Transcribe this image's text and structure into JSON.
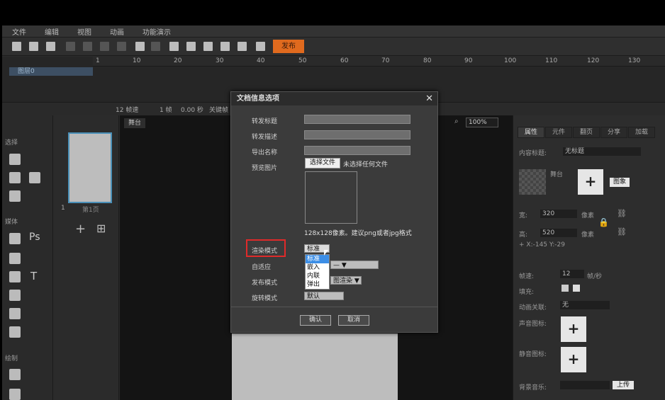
{
  "menu": [
    "文件",
    "编辑",
    "视图",
    "动画",
    "功能演示"
  ],
  "toolbar": {
    "publish_label": "发布"
  },
  "timeline": {
    "ticks": [
      "1",
      "10",
      "20",
      "30",
      "40",
      "50",
      "60",
      "70",
      "80",
      "90",
      "100",
      "110",
      "120",
      "130"
    ],
    "layer_name": "图层0",
    "status": {
      "fps": "12 帧速",
      "frame": "1 帧",
      "time": "0.00 秒",
      "keyframe": "关键帧"
    }
  },
  "left_panel": {
    "select_section": "选择",
    "media_section": "媒体",
    "draw_section": "绘制",
    "ps_label": "Ps",
    "text_label": "T"
  },
  "pages": {
    "page_number": "1",
    "page_label": "第1页"
  },
  "stage": {
    "tab_label": "舞台",
    "zoom": "100%"
  },
  "right_panel": {
    "tabs": [
      "属性",
      "元件",
      "翻页",
      "分享",
      "加载"
    ],
    "content_title_label": "内容标题:",
    "content_title_value": "无标题",
    "stage_label": "舞台",
    "image_button": "图象",
    "width_label": "宽:",
    "width_value": "320",
    "width_unit": "像素",
    "height_label": "高:",
    "height_value": "520",
    "height_unit": "像素",
    "coords": "+  X:-145   Y:-29",
    "fps_label": "帧速:",
    "fps_value": "12",
    "fps_unit": "帧/秒",
    "fill_label": "填充:",
    "anim_link_label": "动画关联:",
    "anim_link_value": "无",
    "sound_icon_label": "声音图标:",
    "mute_icon_label": "静音图标:",
    "bg_music_label": "背景音乐:",
    "upload_button": "上传"
  },
  "dialog": {
    "title": "文档信息选项",
    "share_title_label": "转发标题",
    "share_desc_label": "转发描述",
    "export_name_label": "导出名称",
    "preview_label": "预览图片",
    "choose_file": "选择文件",
    "no_file": "未选择任何文件",
    "size_hint": "128x128像素。建议png或者jpg格式",
    "render_mode_label": "渲染模式",
    "render_mode_value": "标准",
    "adaptive_label": "自适应",
    "adaptive_value": "— ▼",
    "publish_mode_label": "发布模式",
    "publish_mode_value": "图渲染 ▼",
    "rotate_mode_label": "旋转模式",
    "rotate_mode_value": "默认",
    "dropdown_options": [
      "标准",
      "嵌入",
      "内联",
      "弹出"
    ],
    "ok": "确认",
    "cancel": "取消"
  }
}
